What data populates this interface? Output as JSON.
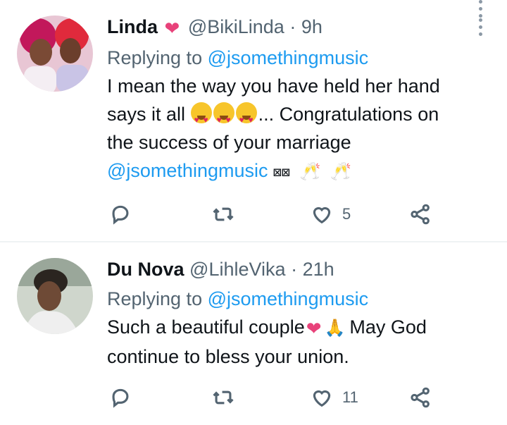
{
  "tweets": [
    {
      "name": "Linda",
      "handle": "@BikiLinda",
      "dot": "·",
      "time": "9h",
      "replying_prefix": "Replying to",
      "replying_to": "@jsomethingmusic",
      "text_line1": "I mean the way you have held her hand",
      "text_line2_start": "says it all",
      "text_line2_end": "... Congratulations on",
      "text_line3": "the success of your marriage",
      "text_line4_mention": "@jsomethingmusic",
      "text_line4_boxes": "⊠⊠",
      "reply_count": "",
      "retweet_count": "",
      "like_count": "5"
    },
    {
      "name": "Du Nova",
      "handle": "@LihleVika",
      "dot": "·",
      "time": "21h",
      "replying_prefix": "Replying to",
      "replying_to": "@jsomethingmusic",
      "text_line1_start": "Such a beautiful couple",
      "text_line1_end": "May God",
      "text_line2": "continue to bless your union.",
      "reply_count": "",
      "retweet_count": "",
      "like_count": "11"
    }
  ],
  "icons": {
    "reply": "reply-icon",
    "retweet": "retweet-icon",
    "like": "heart-icon",
    "share": "share-icon",
    "more": "more-vertical-icon"
  },
  "colors": {
    "link": "#1d9bf0",
    "secondary_text": "#536471",
    "primary_text": "#0f1419"
  }
}
